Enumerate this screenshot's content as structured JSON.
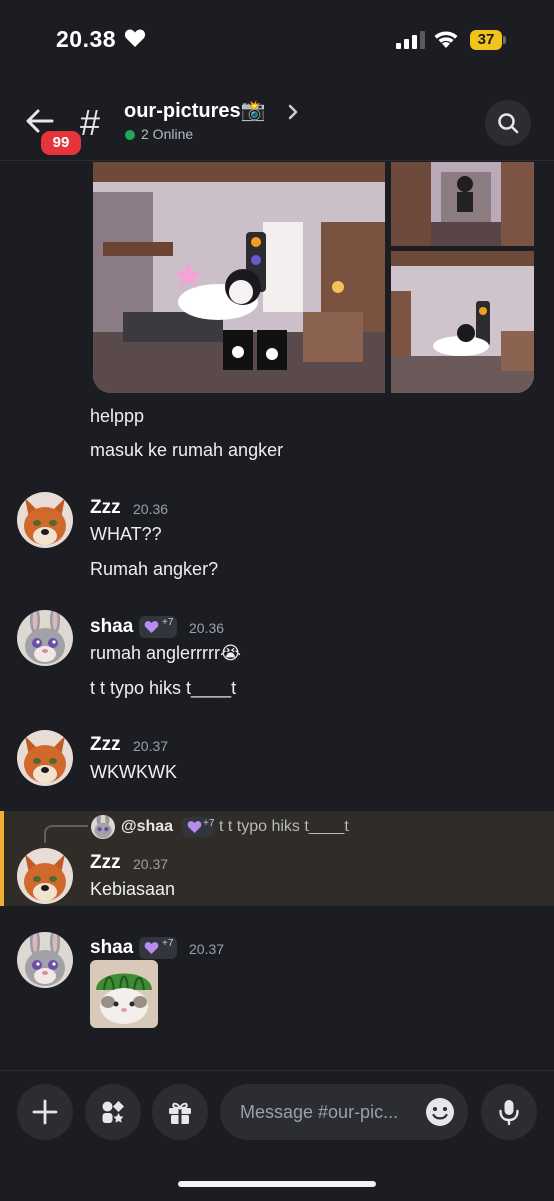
{
  "status_bar": {
    "time": "20.38",
    "battery": "37"
  },
  "header": {
    "unread_badge": "99",
    "channel_name": "our-pictures📸",
    "online_status": "2 Online"
  },
  "messages": {
    "top_lines": [
      "helppp",
      "masuk ke rumah angker"
    ],
    "group1": {
      "author": "Zzz",
      "time": "20.36",
      "lines": [
        "WHAT??",
        "Rumah angker?"
      ]
    },
    "group2": {
      "author": "shaa",
      "role_count": "+7",
      "time": "20.36",
      "lines": [
        "rumah anglerrrrr😭",
        "t t typo hiks t____t"
      ]
    },
    "group3": {
      "author": "Zzz",
      "time": "20.37",
      "lines": [
        "WKWKWK"
      ]
    },
    "group4": {
      "reply_to_author": "@shaa",
      "reply_role_count": "+7",
      "reply_text": "t t typo hiks t____t",
      "author": "Zzz",
      "time": "20.37",
      "lines": [
        "Kebiasaan"
      ]
    },
    "group5": {
      "author": "shaa",
      "role_count": "+7",
      "time": "20.37"
    }
  },
  "input": {
    "placeholder": "Message #our-pic..."
  },
  "icons": {
    "back": "back-arrow-icon",
    "search": "search-icon",
    "add": "plus-icon",
    "apps": "apps-icon",
    "gift": "gift-icon",
    "emoji": "emoji-icon",
    "mic": "microphone-icon"
  },
  "colors": {
    "background": "#1c1d22",
    "online": "#23a55a",
    "badge": "#e5353b",
    "reply_highlight": "#302c27",
    "reply_bar": "#f0b132"
  }
}
